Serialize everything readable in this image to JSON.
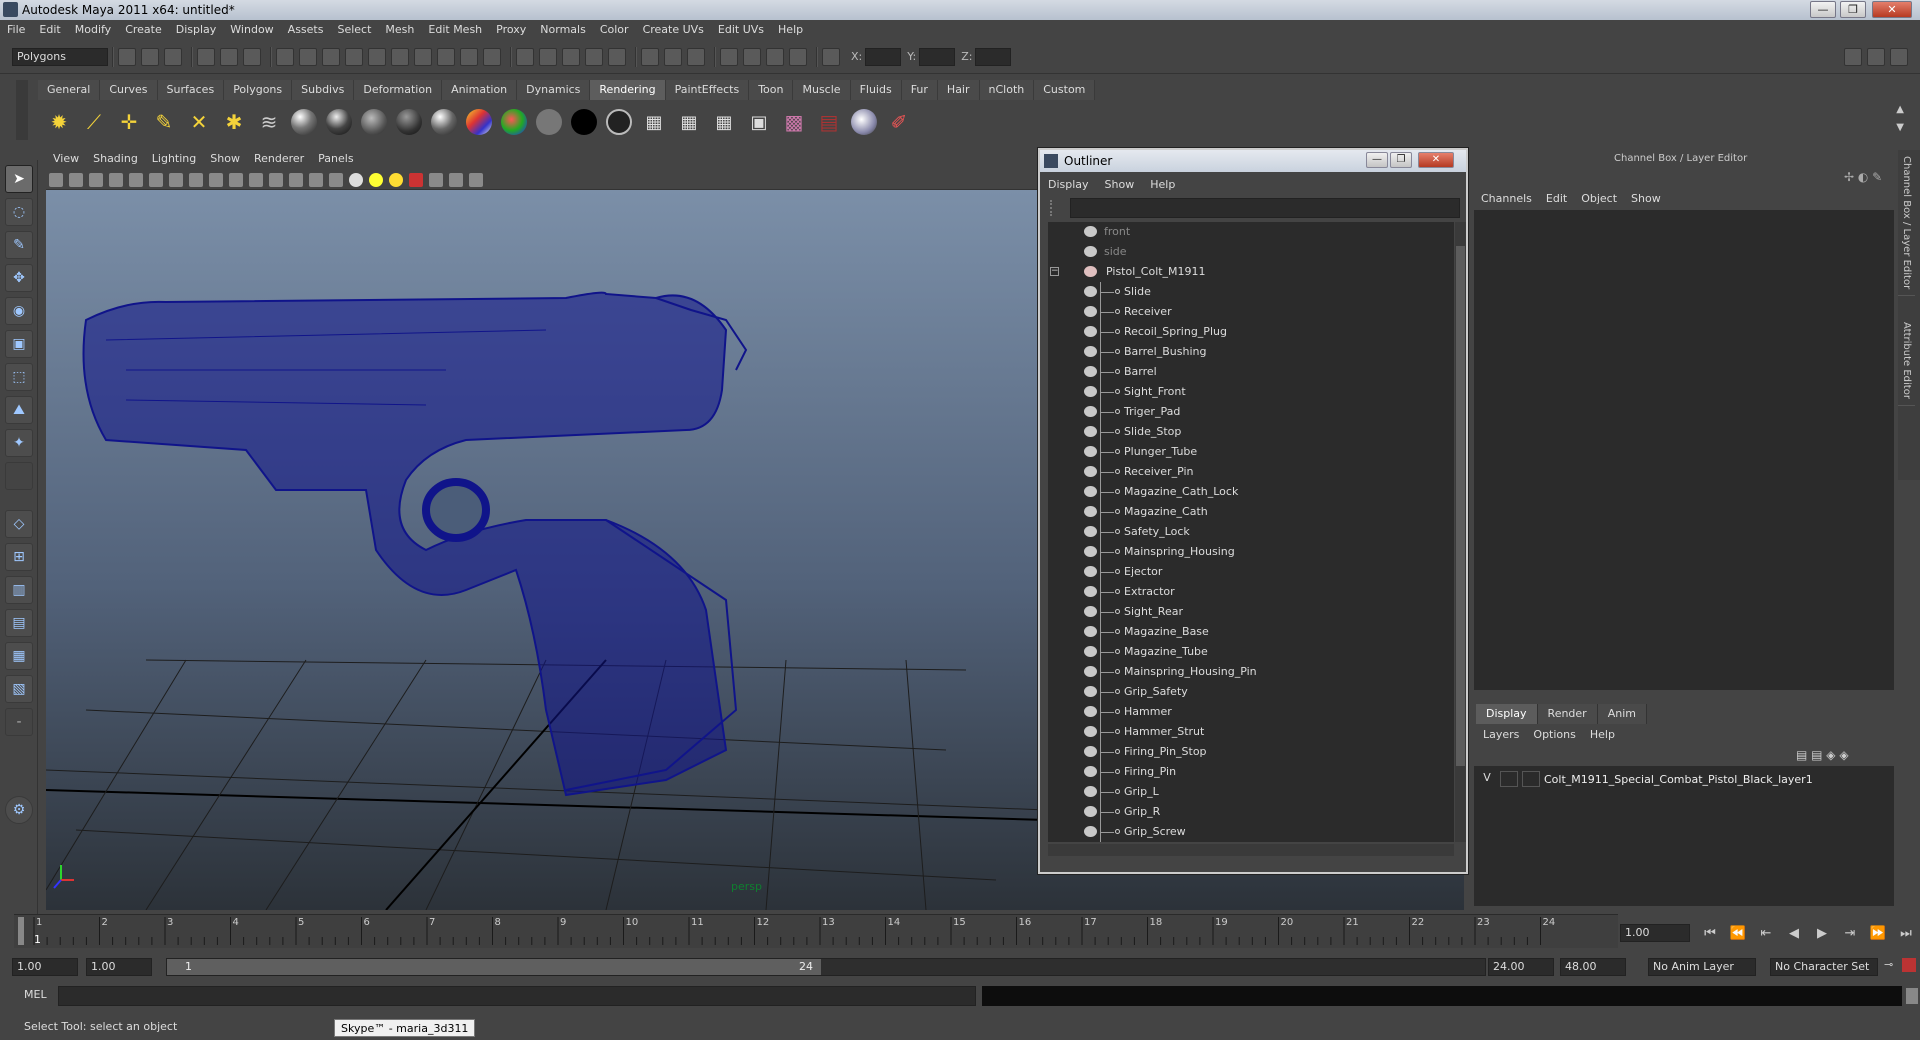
{
  "window": {
    "title": "Autodesk Maya 2011 x64: untitled*",
    "controls": [
      "—",
      "❐",
      "✕"
    ]
  },
  "menubar": [
    "File",
    "Edit",
    "Modify",
    "Create",
    "Display",
    "Window",
    "Assets",
    "Select",
    "Mesh",
    "Edit Mesh",
    "Proxy",
    "Normals",
    "Color",
    "Create UVs",
    "Edit UVs",
    "Help"
  ],
  "statusline": {
    "mode": "Polygons",
    "x_label": "X:",
    "y_label": "Y:",
    "z_label": "Z:"
  },
  "shelf": {
    "tabs": [
      "General",
      "Curves",
      "Surfaces",
      "Polygons",
      "Subdivs",
      "Deformation",
      "Animation",
      "Dynamics",
      "Rendering",
      "PaintEffects",
      "Toon",
      "Muscle",
      "Fluids",
      "Fur",
      "Hair",
      "nCloth",
      "Custom"
    ],
    "active_tab": "Rendering",
    "icons": [
      "ambient-light-icon",
      "directional-light-icon",
      "point-light-icon",
      "spot-light-icon",
      "area-light-icon",
      "volume-light-icon",
      "render-settings-icon",
      "blinn-icon",
      "phong-icon",
      "lambert-icon",
      "anisotropic-icon",
      "phong-e-icon",
      "ramp-shader-icon",
      "surface-shader-icon",
      "use-background-icon",
      "layered-shader-icon",
      "ocean-shader-icon",
      "render-icon",
      "ipr-render-icon",
      "render-region-icon",
      "render-view-icon",
      "hypershade-icon",
      "batch-render-icon",
      "mental-ray-icon",
      "paint-icon"
    ]
  },
  "viewport": {
    "menu": [
      "View",
      "Shading",
      "Lighting",
      "Show",
      "Renderer",
      "Panels"
    ],
    "camera_label": "persp",
    "background_top": "#7b8fa8",
    "background_bottom": "#2c3239",
    "wireframe_color": "#10148a"
  },
  "outliner": {
    "title": "Outliner",
    "menu": [
      "Display",
      "Show",
      "Help"
    ],
    "cameras": [
      "front",
      "side"
    ],
    "root": "Pistol_Colt_M1911",
    "children": [
      "Slide",
      "Receiver",
      "Recoil_Spring_Plug",
      "Barrel_Bushing",
      "Barrel",
      "Sight_Front",
      "Triger_Pad",
      "Slide_Stop",
      "Plunger_Tube",
      "Receiver_Pin",
      "Magazine_Cath_Lock",
      "Magazine_Cath",
      "Safety_Lock",
      "Mainspring_Housing",
      "Ejector",
      "Extractor",
      "Sight_Rear",
      "Magazine_Base",
      "Magazine_Tube",
      "Mainspring_Housing_Pin",
      "Grip_Safety",
      "Hammer",
      "Hammer_Strut",
      "Firing_Pin_Stop",
      "Firing_Pin",
      "Grip_L",
      "Grip_R",
      "Grip_Screw"
    ]
  },
  "channel_box": {
    "title": "Channel Box / Layer Editor",
    "menu": [
      "Channels",
      "Edit",
      "Object",
      "Show"
    ],
    "side_tabs": [
      "Channel Box / Layer Editor",
      "Attribute Editor"
    ]
  },
  "layer_editor": {
    "tabs": [
      "Display",
      "Render",
      "Anim"
    ],
    "active_tab": "Display",
    "menu": [
      "Layers",
      "Options",
      "Help"
    ],
    "layers": [
      {
        "visible": "V",
        "name": "Colt_M1911_Special_Combat_Pistol_Black_layer1"
      }
    ]
  },
  "timeslider": {
    "ticks": [
      "1",
      "2",
      "3",
      "4",
      "5",
      "6",
      "7",
      "8",
      "9",
      "10",
      "11",
      "12",
      "13",
      "14",
      "15",
      "16",
      "17",
      "18",
      "19",
      "20",
      "21",
      "22",
      "23",
      "24"
    ],
    "current_frame_marker": "1",
    "current_frame": "1.00",
    "playback_buttons": [
      "go-to-start-icon",
      "step-back-key-icon",
      "step-back-frame-icon",
      "play-backward-icon",
      "play-forward-icon",
      "step-forward-frame-icon",
      "step-forward-key-icon",
      "go-to-end-icon"
    ]
  },
  "rangeslider": {
    "start_time": "1.00",
    "playback_start": "1.00",
    "range_start": "1",
    "range_end": "24",
    "playback_end": "24.00",
    "end_time": "48.00",
    "anim_layer": "No Anim Layer",
    "character_set": "No Character Set"
  },
  "cmdline": {
    "label": "MEL"
  },
  "helpline": {
    "text": "Select Tool: select an object",
    "tooltip": "Skype™ - maria_3d311"
  }
}
